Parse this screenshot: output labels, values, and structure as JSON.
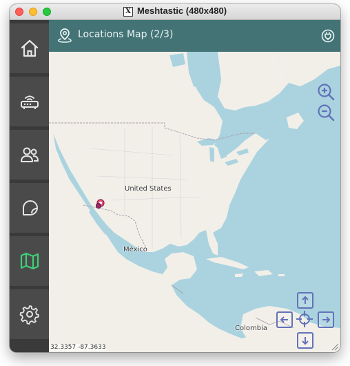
{
  "window": {
    "title": "Meshtastic (480x480)",
    "x_glyph": "X"
  },
  "sidebar": {
    "items": [
      {
        "name": "home-icon",
        "active": false
      },
      {
        "name": "router-icon",
        "active": false
      },
      {
        "name": "users-icon",
        "active": false
      },
      {
        "name": "chat-icon",
        "active": false
      },
      {
        "name": "map-icon",
        "active": true
      },
      {
        "name": "gear-icon",
        "active": false
      }
    ],
    "active_color": "#3fcf7a",
    "inactive_color": "#e6e6e6"
  },
  "header": {
    "title": "Locations Map (2/3)",
    "left_icon": "location-pin-icon",
    "right_icon": "plug-icon"
  },
  "map": {
    "labels": {
      "country_1": "United States",
      "country_2": "México",
      "country_3": "Colombia"
    },
    "coordinates": "32.3357 -87.3633",
    "controls": {
      "zoom_in": "zoom-in-icon",
      "zoom_out": "zoom-out-icon",
      "pan_up": "arrow-up-icon",
      "pan_down": "arrow-down-icon",
      "pan_left": "arrow-left-icon",
      "pan_right": "arrow-right-icon",
      "center": "crosshair-icon"
    },
    "colors": {
      "water": "#aad3df",
      "land": "#f2efe9",
      "header": "#437375",
      "controls": "#6272b8",
      "marker": "#c0306a"
    }
  }
}
